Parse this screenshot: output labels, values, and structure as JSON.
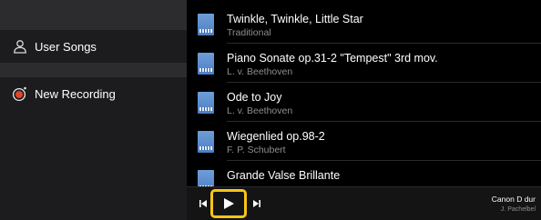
{
  "sidebar": {
    "items": [
      {
        "label": "User Songs",
        "icon": "user-icon"
      },
      {
        "label": "New Recording",
        "icon": "record-icon",
        "icon_color": "#e0452b"
      }
    ]
  },
  "songs": [
    {
      "title": "Twinkle, Twinkle, Little Star",
      "artist": "Traditional"
    },
    {
      "title": "Piano Sonate op.31-2 \"Tempest\" 3rd mov.",
      "artist": "L. v. Beethoven"
    },
    {
      "title": "Ode to Joy",
      "artist": "L. v. Beethoven"
    },
    {
      "title": "Wiegenlied op.98-2",
      "artist": "F. P. Schubert"
    },
    {
      "title": "Grande Valse Brillante",
      "artist": ""
    }
  ],
  "player": {
    "controls": [
      "previous-track-icon",
      "play-icon",
      "next-track-icon"
    ],
    "highlight_color": "#f5c518",
    "now_playing": {
      "title": "Canon D dur",
      "artist": "J. Pachelbel"
    }
  },
  "colors": {
    "background": "#000000",
    "sidebar": "#1c1c1e",
    "primary_text": "#ffffff",
    "secondary_text": "#8e8e93",
    "thumbnail": "#5b8fd1"
  }
}
